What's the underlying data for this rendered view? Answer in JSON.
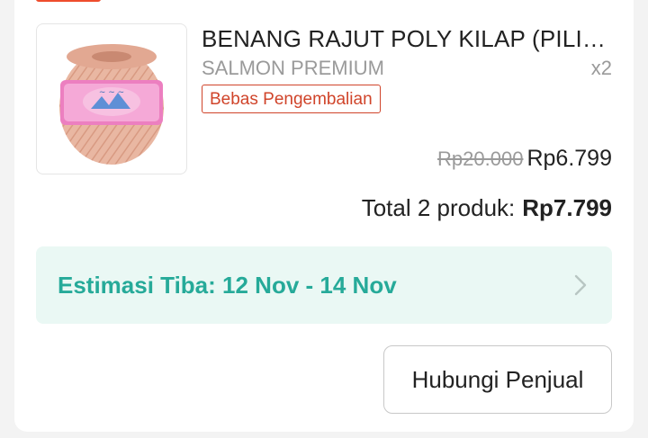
{
  "product": {
    "title": "BENANG RAJUT POLY KILAP (PILIH WARNA)",
    "variant": "SALMON PREMIUM",
    "quantity": "x2",
    "return_badge": "Bebas Pengembalian",
    "original_price": "Rp20.000",
    "current_price": "Rp6.799",
    "image_icon": "yarn-ball-image"
  },
  "total": {
    "label": "Total 2 produk:",
    "value": "Rp7.799"
  },
  "estimate": {
    "text": "Estimasi Tiba: 12 Nov - 14 Nov",
    "icon": "chevron-right-icon"
  },
  "actions": {
    "contact_seller": "Hubungi Penjual"
  },
  "colors": {
    "brand": "#ee4d2d",
    "return_badge": "#d0442a",
    "estimate_text": "#26aa99",
    "estimate_bg": "#eaf8f4"
  }
}
